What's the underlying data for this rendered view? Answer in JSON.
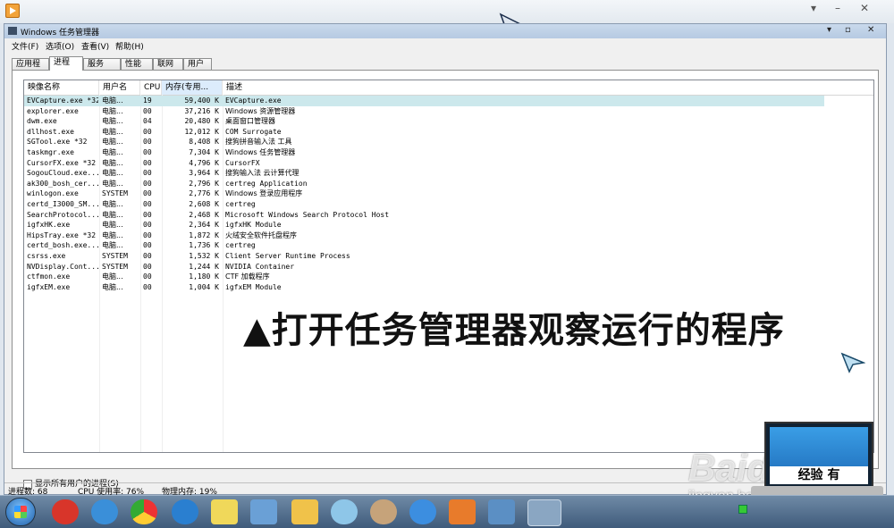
{
  "window": {
    "title": "Windows 任务管理器",
    "controls": [
      "▾",
      "▫",
      "✕"
    ]
  },
  "menu": [
    "文件(F)",
    "选项(O)",
    "查看(V)",
    "帮助(H)"
  ],
  "tabs": [
    "应用程序",
    "进程",
    "服务",
    "性能",
    "联网",
    "用户"
  ],
  "active_tab": "进程",
  "columns": [
    "映像名称",
    "用户名",
    "CPU",
    "内存(专用...",
    "描述"
  ],
  "rows": [
    {
      "name": "EVCapture.exe *32",
      "user": "电脑...",
      "cpu": "19",
      "mem": "59,400 K",
      "desc": "EVCapture.exe"
    },
    {
      "name": "explorer.exe",
      "user": "电脑...",
      "cpu": "00",
      "mem": "37,216 K",
      "desc": "Windows 资源管理器"
    },
    {
      "name": "dwm.exe",
      "user": "电脑...",
      "cpu": "04",
      "mem": "20,480 K",
      "desc": "桌面窗口管理器"
    },
    {
      "name": "dllhost.exe",
      "user": "电脑...",
      "cpu": "00",
      "mem": "12,012 K",
      "desc": "COM Surrogate"
    },
    {
      "name": "SGTool.exe *32",
      "user": "电脑...",
      "cpu": "00",
      "mem": "8,408 K",
      "desc": "搜狗拼音输入法 工具"
    },
    {
      "name": "taskmgr.exe",
      "user": "电脑...",
      "cpu": "00",
      "mem": "7,304 K",
      "desc": "Windows 任务管理器"
    },
    {
      "name": "CursorFX.exe *32",
      "user": "电脑...",
      "cpu": "00",
      "mem": "4,796 K",
      "desc": "CursorFX"
    },
    {
      "name": "SogouCloud.exe...",
      "user": "电脑...",
      "cpu": "00",
      "mem": "3,964 K",
      "desc": "搜狗输入法 云计算代理"
    },
    {
      "name": "ak300_bosh_cer...",
      "user": "电脑...",
      "cpu": "00",
      "mem": "2,796 K",
      "desc": "certreg Application"
    },
    {
      "name": "winlogon.exe",
      "user": "SYSTEM",
      "cpu": "00",
      "mem": "2,776 K",
      "desc": "Windows 登录应用程序"
    },
    {
      "name": "certd_I3000_SM...",
      "user": "电脑...",
      "cpu": "00",
      "mem": "2,608 K",
      "desc": "certreg"
    },
    {
      "name": "SearchProtocol...",
      "user": "电脑...",
      "cpu": "00",
      "mem": "2,468 K",
      "desc": "Microsoft Windows Search Protocol Host"
    },
    {
      "name": "igfxHK.exe",
      "user": "电脑...",
      "cpu": "00",
      "mem": "2,364 K",
      "desc": "igfxHK Module"
    },
    {
      "name": "HipsTray.exe *32",
      "user": "电脑...",
      "cpu": "00",
      "mem": "1,872 K",
      "desc": "火绒安全软件托盘程序"
    },
    {
      "name": "certd_bosh.exe...",
      "user": "电脑...",
      "cpu": "00",
      "mem": "1,736 K",
      "desc": "certreg"
    },
    {
      "name": "csrss.exe",
      "user": "SYSTEM",
      "cpu": "00",
      "mem": "1,532 K",
      "desc": "Client Server Runtime Process"
    },
    {
      "name": "NVDisplay.Cont...",
      "user": "SYSTEM",
      "cpu": "00",
      "mem": "1,244 K",
      "desc": "NVIDIA Container"
    },
    {
      "name": "ctfmon.exe",
      "user": "电脑...",
      "cpu": "00",
      "mem": "1,180 K",
      "desc": "CTF 加载程序"
    },
    {
      "name": "igfxEM.exe",
      "user": "电脑...",
      "cpu": "00",
      "mem": "1,004 K",
      "desc": "igfxEM Module"
    }
  ],
  "show_all_label": "显示所有用户的进程(S)",
  "status": {
    "processes": "进程数: 68",
    "cpu": "CPU 使用率: 76%",
    "memory": "物理内存: 19%"
  },
  "caption": "▲打开任务管理器观察运行的程序",
  "watermark": {
    "brand": "Baidu",
    "sub": "jingyan.baidu.com",
    "badge": "经验",
    "badge_suffix": "有"
  },
  "taskbar_icons": [
    "windows-start-icon",
    "sogou-icon",
    "ie-icon",
    "chrome-icon",
    "edge-icon",
    "sticky-icon",
    "network-icon",
    "folder-icon",
    "pinwheel-icon",
    "paint-icon",
    "circle-app-icon",
    "media-icon",
    "calendar-icon",
    "taskmgr-icon"
  ],
  "colors": {
    "selected_row": "#cce8ec",
    "sorted_header": "#dcecfc",
    "taskbar": "#4f6b8b"
  }
}
